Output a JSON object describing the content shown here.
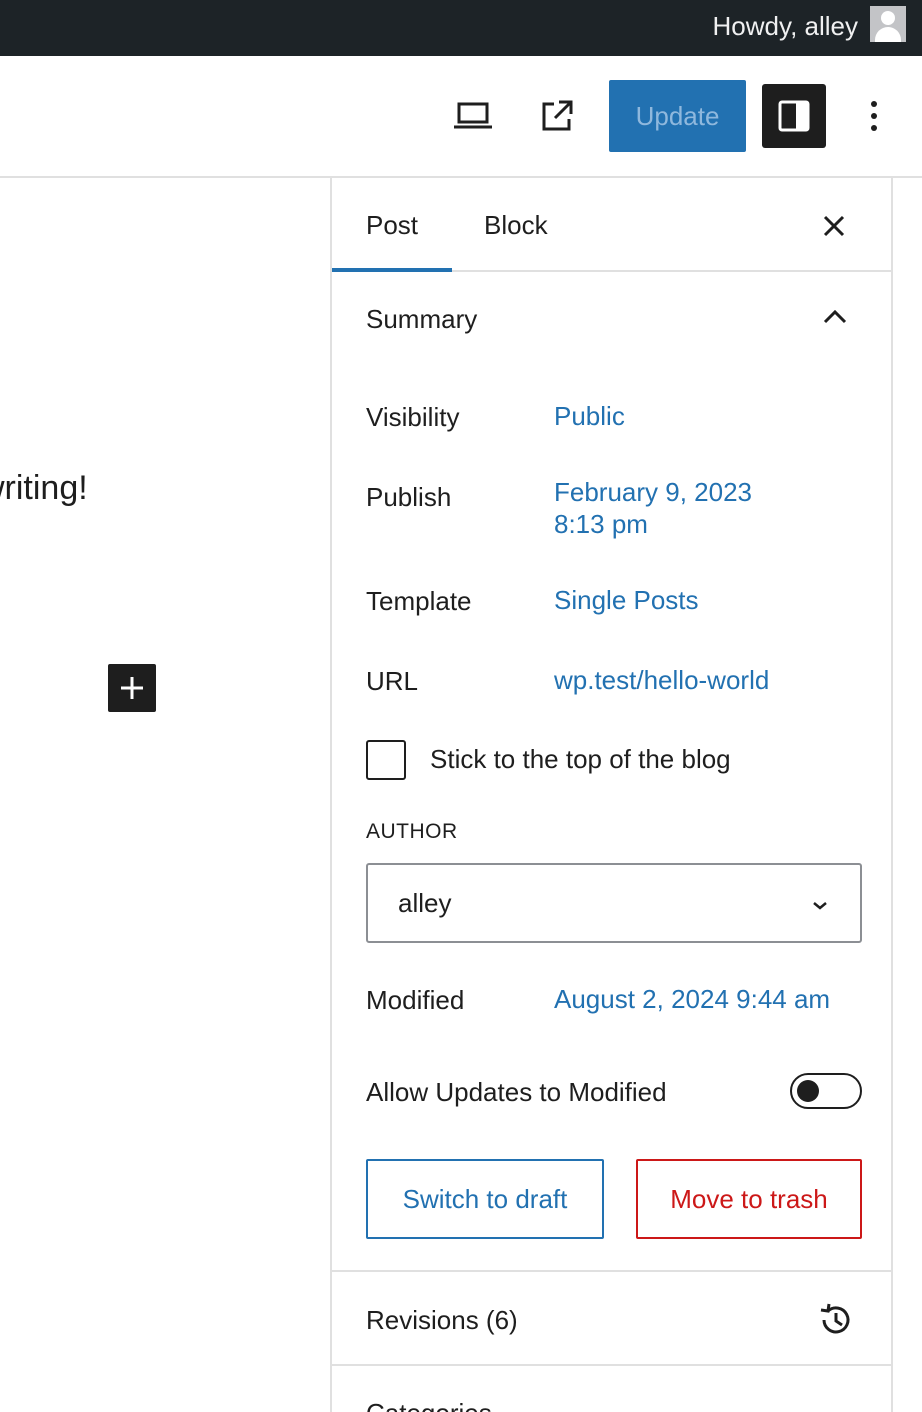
{
  "admin_bar": {
    "greeting": "Howdy, alley"
  },
  "toolbar": {
    "preview_icon": "laptop-icon",
    "view_post_icon": "external-link-icon",
    "update_label": "Update",
    "settings_icon": "sidebar-toggle-icon",
    "options_icon": "more-vertical-icon"
  },
  "canvas": {
    "paragraph_fragment": "writing!",
    "inserter_icon": "plus-icon"
  },
  "sidebar": {
    "tabs": [
      {
        "label": "Post",
        "active": true
      },
      {
        "label": "Block",
        "active": false
      }
    ],
    "summary": {
      "title": "Summary",
      "visibility_label": "Visibility",
      "visibility_value": "Public",
      "publish_label": "Publish",
      "publish_date": "February 9, 2023",
      "publish_time": "8:13 pm",
      "template_label": "Template",
      "template_value": "Single Posts",
      "url_label": "URL",
      "url_value": "wp.test/hello-world",
      "sticky_label": "Stick to the top of the blog",
      "sticky_checked": false,
      "author_label": "AUTHOR",
      "author_value": "alley",
      "modified_label": "Modified",
      "modified_value": "August 2, 2024 9:44 am",
      "allow_updates_label": "Allow Updates to Modified",
      "allow_updates_on": false,
      "switch_draft_label": "Switch to draft",
      "trash_label": "Move to trash"
    },
    "revisions_label": "Revisions (6)",
    "categories_label": "Categories"
  },
  "colors": {
    "admin_bar": "#1d2327",
    "accent": "#2271b1",
    "danger": "#cc1818",
    "dark": "#1e1e1e"
  }
}
